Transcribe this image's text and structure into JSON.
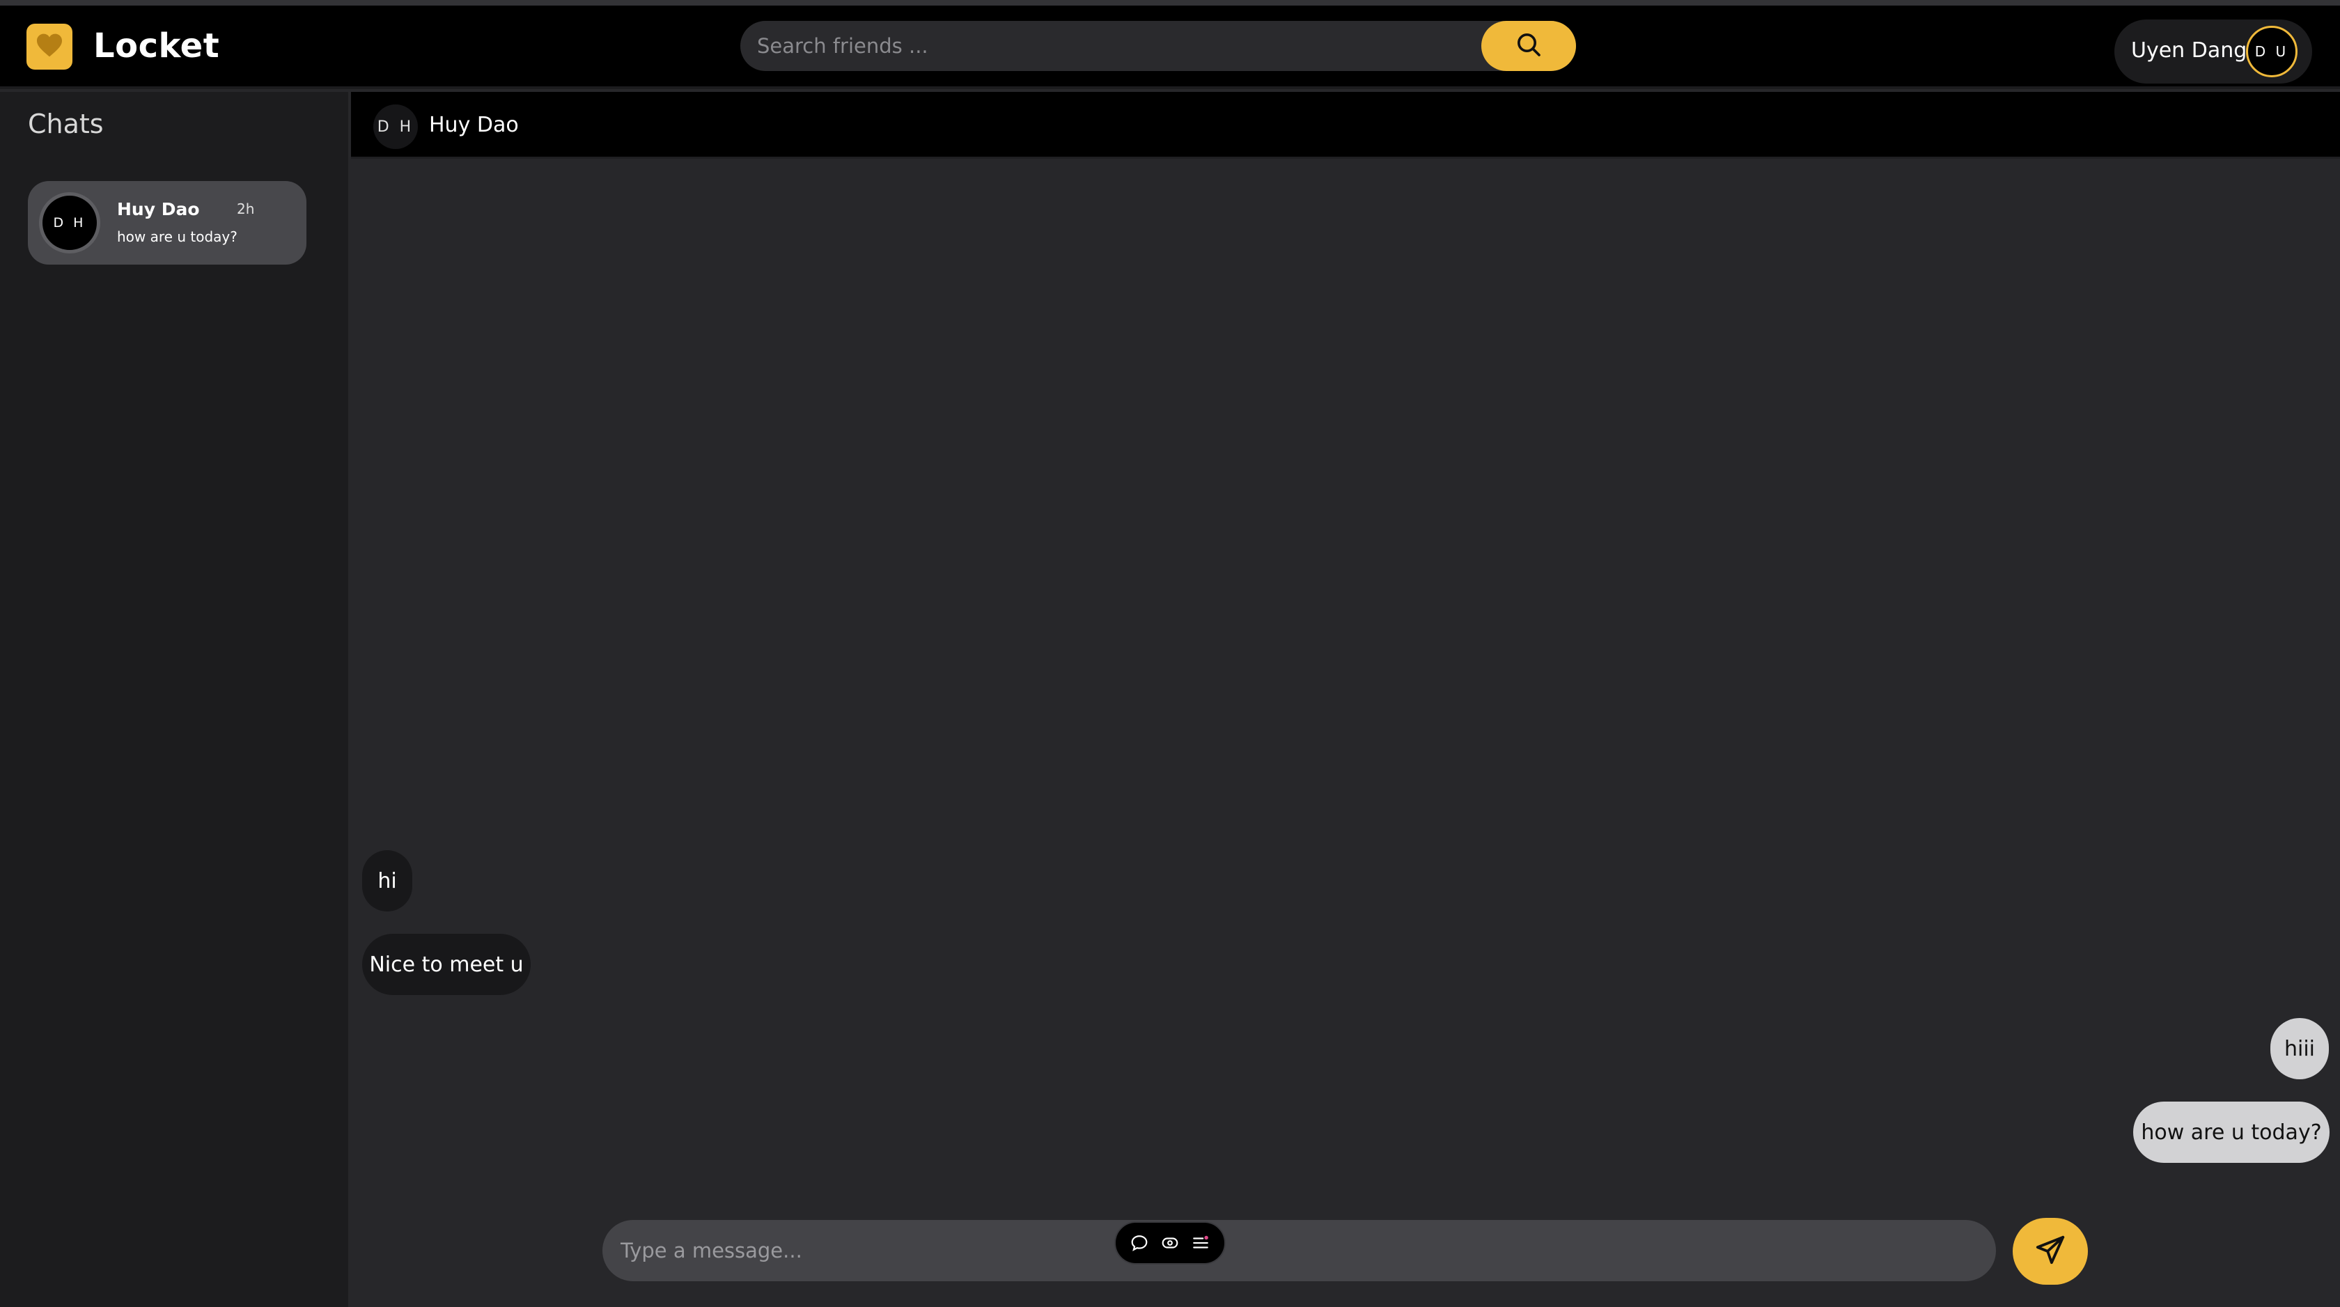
{
  "app": {
    "name": "Locket",
    "logo_icon": "heart-icon",
    "accent": "#f0b93a"
  },
  "search": {
    "placeholder": "Search friends ...",
    "button_icon": "search-icon"
  },
  "user": {
    "name": "Uyen Dang",
    "initials": "D U"
  },
  "sidebar": {
    "title": "Chats",
    "items": [
      {
        "initials": "D H",
        "name": "Huy Dao",
        "time": "2h",
        "preview": "how are u today?"
      }
    ]
  },
  "conversation": {
    "contact_initials": "D H",
    "contact_name": "Huy Dao",
    "messages": [
      {
        "direction": "incoming",
        "text": "hi"
      },
      {
        "direction": "incoming",
        "text": "Nice to meet u"
      },
      {
        "direction": "outgoing",
        "text": "hiii"
      },
      {
        "direction": "outgoing",
        "text": "how are u today?"
      }
    ]
  },
  "composer": {
    "placeholder": "Type a message...",
    "tools": [
      "chat-bubble-icon",
      "emoji-icon",
      "menu-lines-icon"
    ],
    "send_icon": "send-icon"
  }
}
